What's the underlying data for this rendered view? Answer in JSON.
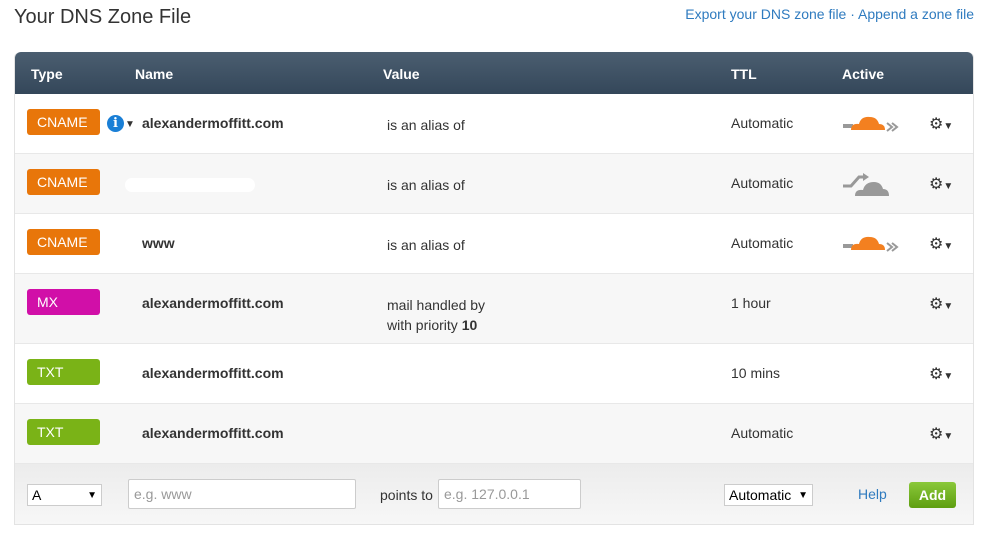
{
  "title": "Your DNS Zone File",
  "links": {
    "export": "Export your DNS zone file",
    "sep": " · ",
    "append": "Append a zone file"
  },
  "columns": {
    "type": "Type",
    "name": "Name",
    "value": "Value",
    "ttl": "TTL",
    "active": "Active"
  },
  "colors": {
    "cname": "#e8760a",
    "mx": "#d10fa8",
    "txt": "#7ab317",
    "cloud_on": "#f38020",
    "cloud_off": "#999999",
    "link": "#2f7bbf"
  },
  "records": [
    {
      "type": "CNAME",
      "name": "alexandermoffitt.com",
      "value": "is an alias of",
      "ttl": "Automatic",
      "active": "cloud-on"
    },
    {
      "type": "CNAME",
      "name": "",
      "value": "is an alias of",
      "ttl": "Automatic",
      "active": "cloud-off"
    },
    {
      "type": "CNAME",
      "name": "www",
      "value": "is an alias of",
      "ttl": "Automatic",
      "active": "cloud-on"
    },
    {
      "type": "MX",
      "name": "alexandermoffitt.com",
      "value": "mail handled by",
      "priority_label": "with priority",
      "priority": "10",
      "ttl": "1 hour"
    },
    {
      "type": "TXT",
      "name": "alexandermoffitt.com",
      "value": "",
      "ttl": "10 mins"
    },
    {
      "type": "TXT",
      "name": "alexandermoffitt.com",
      "value": "",
      "ttl": "Automatic"
    }
  ],
  "form": {
    "type": "A",
    "name_placeholder": "e.g. www",
    "points_to": "points to",
    "value_placeholder": "e.g. 127.0.0.1",
    "ttl": "Automatic",
    "help": "Help",
    "add": "Add"
  }
}
